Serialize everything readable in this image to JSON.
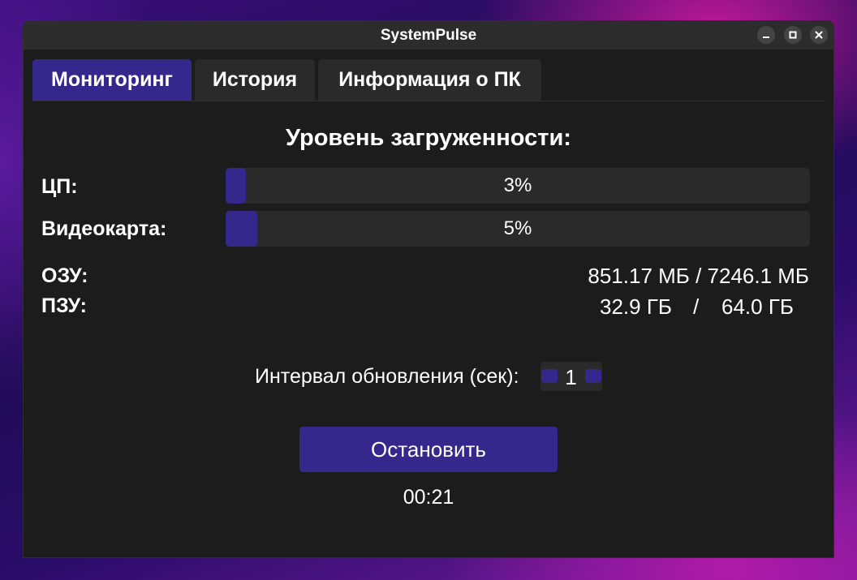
{
  "window": {
    "title": "SystemPulse",
    "controls": [
      "minimize-icon",
      "maximize-icon",
      "close-icon"
    ]
  },
  "tabs": [
    {
      "label": "Мониторинг",
      "active": true
    },
    {
      "label": "История",
      "active": false
    },
    {
      "label": "Информация о ПК",
      "active": false
    }
  ],
  "monitoring": {
    "title": "Уровень загруженности:",
    "cpu": {
      "label": "ЦП:",
      "percent": 3,
      "text": "3%"
    },
    "gpu": {
      "label": "Видеокарта:",
      "percent": 5,
      "text": "5%"
    },
    "ram": {
      "label": "ОЗУ:",
      "value": "851.17 МБ / 7246.1 МБ"
    },
    "rom": {
      "label": "ПЗУ:",
      "used": "32.9 ГБ",
      "separator": "/",
      "total": "64.0 ГБ"
    },
    "interval": {
      "label": "Интервал обновления (сек):",
      "value": "1"
    },
    "stop_button": "Остановить",
    "timer": "00:21"
  },
  "colors": {
    "accent": "#34288c",
    "background": "#1c1c1c",
    "titlebar": "#2c2c2c",
    "track": "#2a2a2a",
    "text": "#ffffff"
  }
}
